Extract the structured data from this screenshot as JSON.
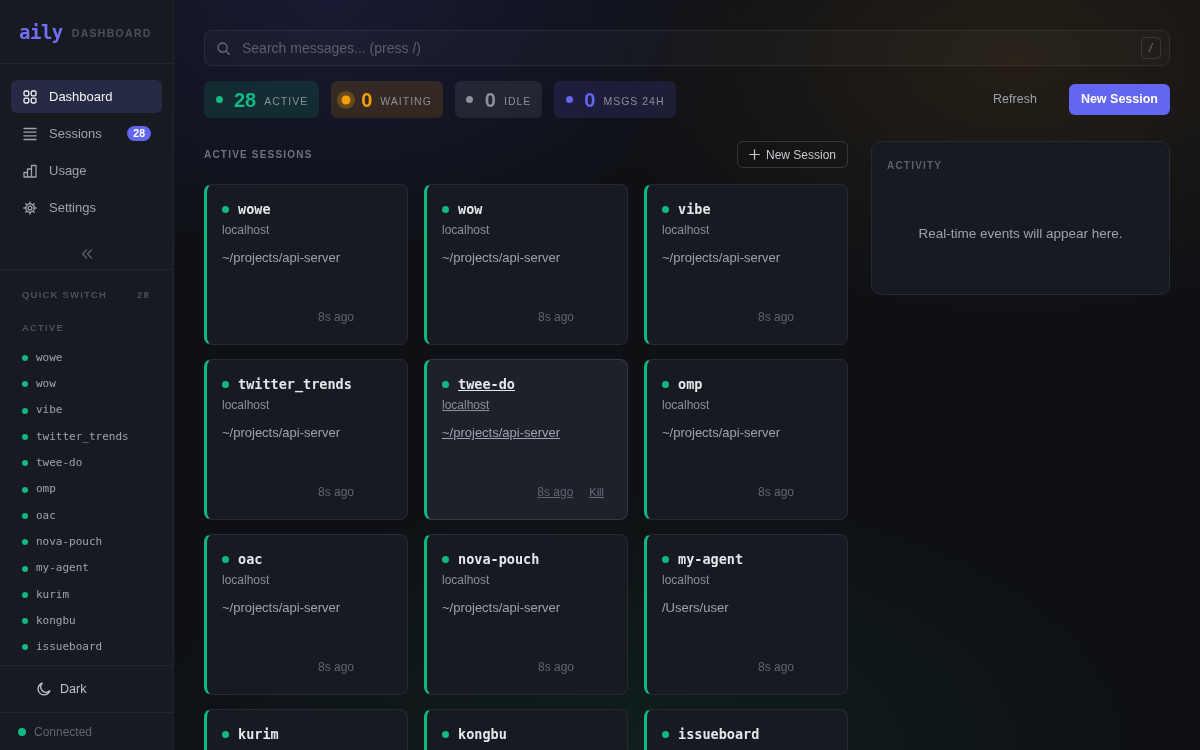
{
  "sidebar": {
    "logo": "aily",
    "subtitle": "DASHBOARD",
    "nav": [
      {
        "label": "Dashboard",
        "selected": true
      },
      {
        "label": "Sessions",
        "badge": "28",
        "selected": false
      },
      {
        "label": "Usage",
        "selected": false
      },
      {
        "label": "Settings",
        "selected": false
      }
    ],
    "quick_switch": {
      "title": "QUICK SWITCH",
      "count": "28",
      "group": "ACTIVE",
      "items": [
        "wowe",
        "wow",
        "vibe",
        "twitter_trends",
        "twee-do",
        "omp",
        "oac",
        "nova-pouch",
        "my-agent",
        "kurim",
        "kongbu",
        "issueboard"
      ]
    },
    "theme_toggle": "Dark",
    "connection": {
      "label": "Connected",
      "connected": true
    }
  },
  "search": {
    "placeholder": "Search messages... (press /)",
    "shortcut": "/"
  },
  "stats": [
    {
      "kind": "active",
      "value": "28",
      "label": "ACTIVE",
      "color": "#10b981"
    },
    {
      "kind": "waiting",
      "value": "0",
      "label": "WAITING",
      "color": "#f59e0b"
    },
    {
      "kind": "idle",
      "value": "0",
      "label": "IDLE",
      "color": "#8b919b"
    },
    {
      "kind": "messages",
      "value": "0",
      "label": "MSGS 24H",
      "color": "#6366f1"
    }
  ],
  "toolbar": {
    "refresh": "Refresh",
    "new_session": "New Session"
  },
  "sessions": {
    "title": "ACTIVE SESSIONS",
    "new_button": "New Session",
    "cards": [
      {
        "name": "wowe",
        "host": "localhost",
        "path": "~/projects/api-server",
        "time": "8s ago",
        "active": true,
        "hovered": false
      },
      {
        "name": "wow",
        "host": "localhost",
        "path": "~/projects/api-server",
        "time": "8s ago",
        "active": true,
        "hovered": false
      },
      {
        "name": "vibe",
        "host": "localhost",
        "path": "~/projects/api-server",
        "time": "8s ago",
        "active": true,
        "hovered": false
      },
      {
        "name": "twitter_trends",
        "host": "localhost",
        "path": "~/projects/api-server",
        "time": "8s ago",
        "active": true,
        "hovered": false
      },
      {
        "name": "twee-do",
        "host": "localhost",
        "path": "~/projects/api-server",
        "time": "8s ago",
        "action": "Kill",
        "active": true,
        "hovered": true
      },
      {
        "name": "omp",
        "host": "localhost",
        "path": "~/projects/api-server",
        "time": "8s ago",
        "active": true,
        "hovered": false
      },
      {
        "name": "oac",
        "host": "localhost",
        "path": "~/projects/api-server",
        "time": "8s ago",
        "active": true,
        "hovered": false
      },
      {
        "name": "nova-pouch",
        "host": "localhost",
        "path": "~/projects/api-server",
        "time": "8s ago",
        "active": true,
        "hovered": false
      },
      {
        "name": "my-agent",
        "host": "localhost",
        "path": "/Users/user",
        "time": "8s ago",
        "active": true,
        "hovered": false
      },
      {
        "name": "kurim",
        "active": true,
        "hovered": false
      },
      {
        "name": "kongbu",
        "active": true,
        "hovered": false
      },
      {
        "name": "issueboard",
        "active": true,
        "hovered": false
      }
    ]
  },
  "activity": {
    "title": "ACTIVITY",
    "empty_message": "Real-time events will appear here."
  }
}
